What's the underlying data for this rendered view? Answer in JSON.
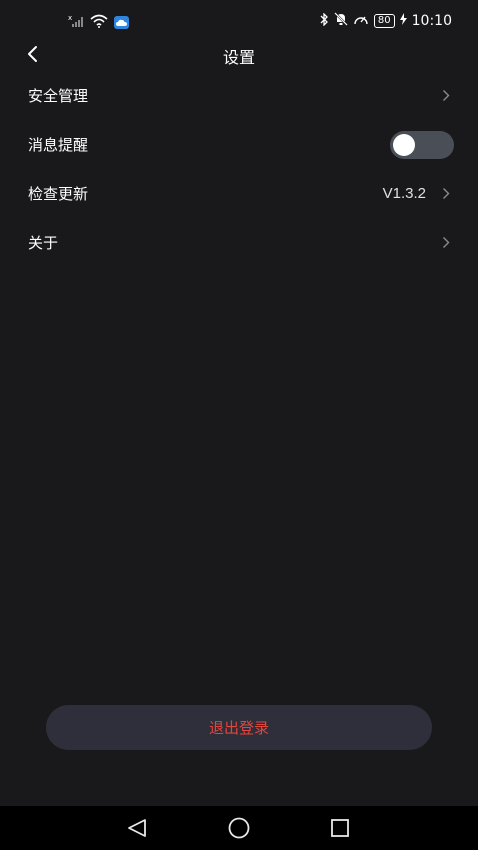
{
  "status_bar": {
    "time": "10:10",
    "battery": "80"
  },
  "header": {
    "title": "设置"
  },
  "menu": {
    "items": [
      {
        "label": "安全管理"
      },
      {
        "label": "消息提醒",
        "toggle_on": false
      },
      {
        "label": "检查更新",
        "value": "V1.3.2"
      },
      {
        "label": "关于"
      }
    ]
  },
  "logout": {
    "label": "退出登录"
  },
  "colors": {
    "background": "#19191c",
    "logout_text": "#e2453c",
    "logout_bg": "#2f2f3b",
    "toggle_track": "#4a4f57"
  }
}
